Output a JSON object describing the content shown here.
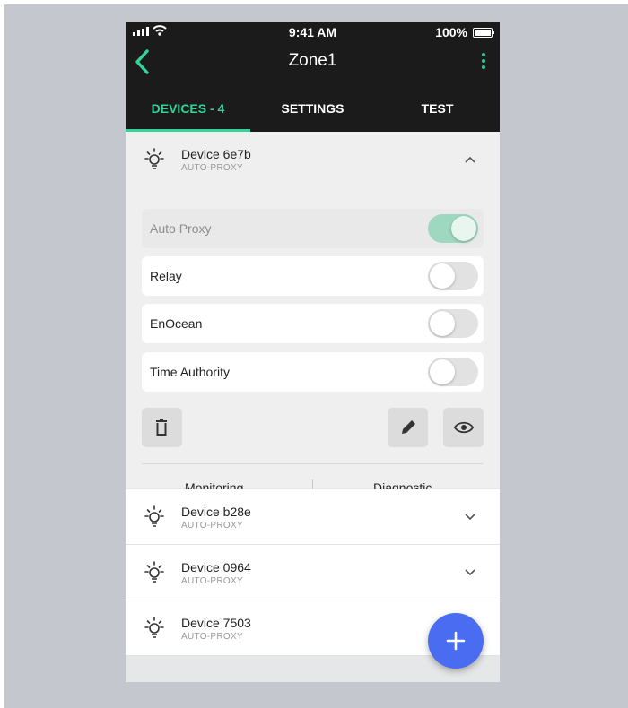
{
  "status_bar": {
    "time": "9:41 AM",
    "battery": "100%"
  },
  "header": {
    "title": "Zone1"
  },
  "tabs": [
    {
      "label": "DEVICES - 4",
      "active": true
    },
    {
      "label": "SETTINGS",
      "active": false
    },
    {
      "label": "TEST",
      "active": false
    }
  ],
  "expanded_device": {
    "name": "Device 6e7b",
    "subtitle": "AUTO-PROXY",
    "icon": "bulb-icon",
    "settings": [
      {
        "label": "Auto Proxy",
        "on": true,
        "disabled": true
      },
      {
        "label": "Relay",
        "on": false,
        "disabled": false
      },
      {
        "label": "EnOcean",
        "on": false,
        "disabled": false
      },
      {
        "label": "Time Authority",
        "on": false,
        "disabled": false
      }
    ],
    "footer": {
      "monitoring": "Monitoring",
      "diagnostic": "Diagnostic"
    }
  },
  "devices": [
    {
      "name": "Device b28e",
      "subtitle": "AUTO-PROXY"
    },
    {
      "name": "Device 0964",
      "subtitle": "AUTO-PROXY"
    },
    {
      "name": "Device 7503",
      "subtitle": "AUTO-PROXY"
    }
  ],
  "colors": {
    "accent": "#35d29a",
    "fab": "#4a6cf0",
    "appbar": "#1b1b1b"
  }
}
